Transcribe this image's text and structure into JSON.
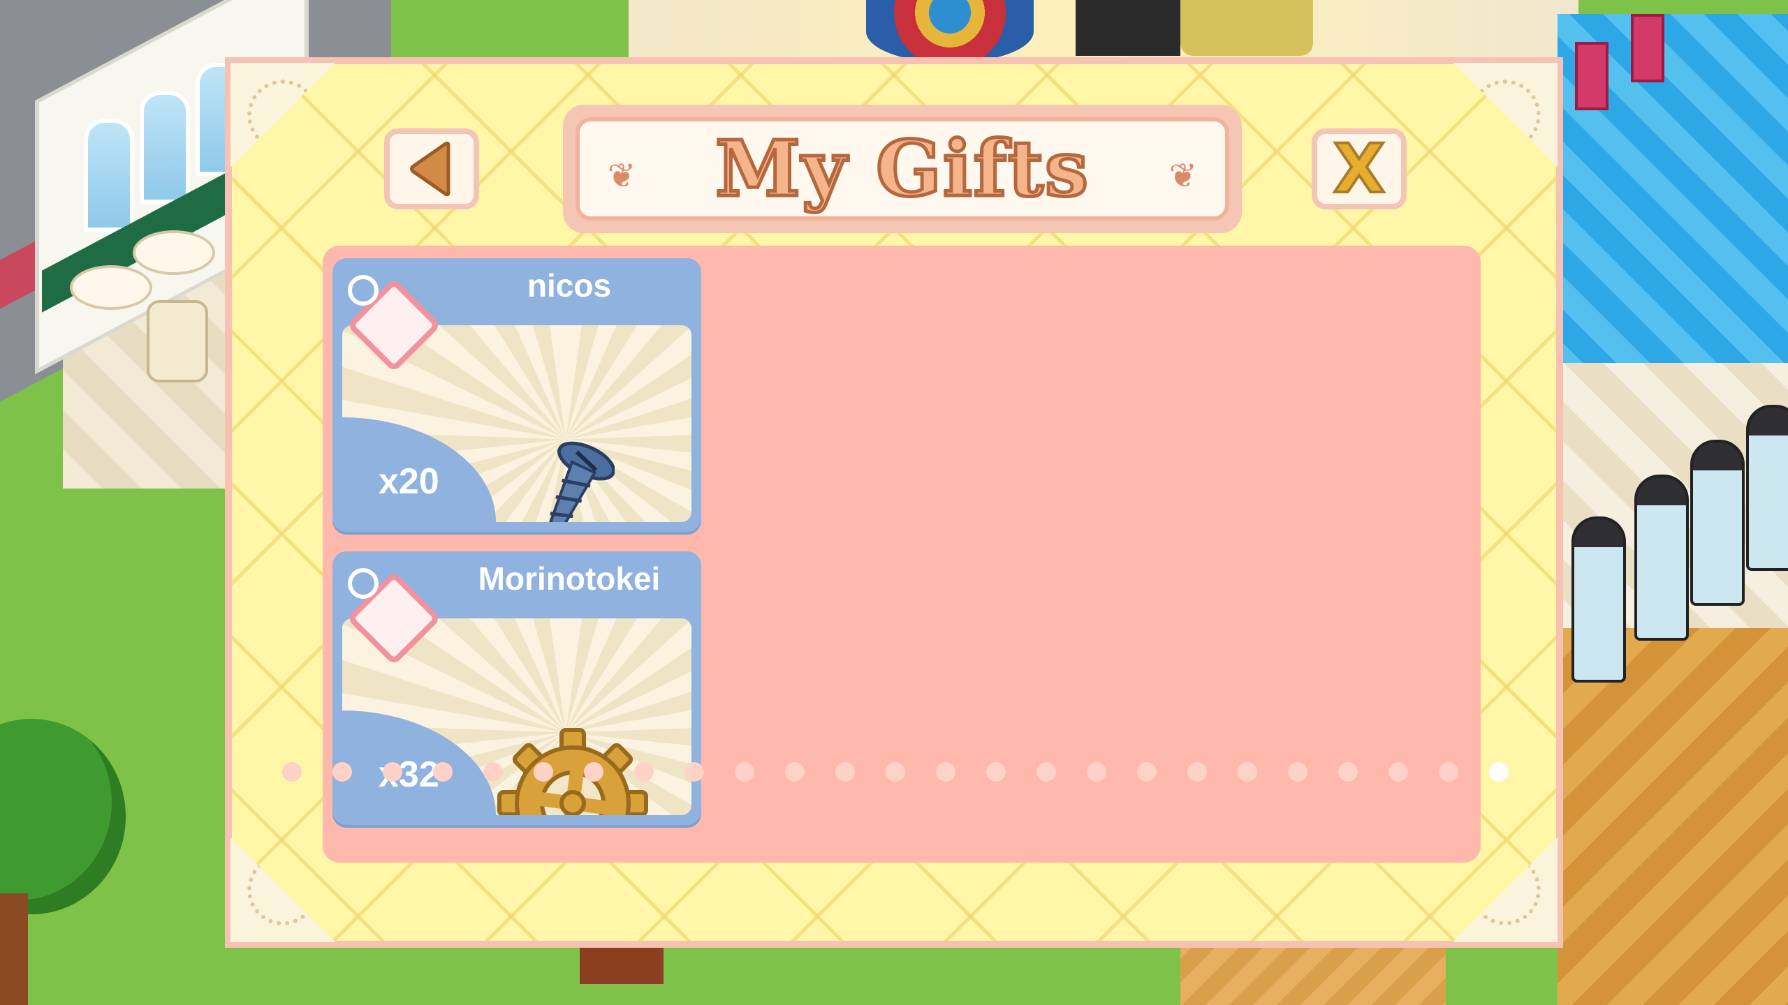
{
  "dialog": {
    "title": "My Gifts",
    "back_icon": "triangle-left-icon",
    "close_label": "X"
  },
  "gifts": [
    {
      "sender": "nicos",
      "item_icon": "screw-icon",
      "quantity": "x20"
    },
    {
      "sender": "Morinotokei",
      "item_icon": "gear-icon",
      "quantity": "x32"
    }
  ],
  "pager": {
    "total_dots": 25,
    "active_index": 24
  },
  "colors": {
    "dialog_bg": "#fff6a8",
    "dialog_border": "#f7c2b3",
    "gift_area": "#ffb8ac",
    "card_blue": "#8fb2de",
    "title_fill": "#f5b48a",
    "close_fill": "#e8ad2c"
  }
}
